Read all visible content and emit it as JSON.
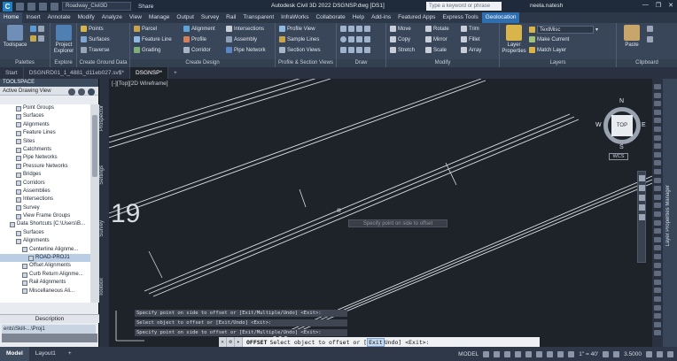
{
  "titlebar": {
    "logo": "C",
    "workspace": "Civil 3D",
    "workspace_field": "Roadway_Civil3D",
    "share": "Share",
    "app_title": "Autodesk Civil 3D 2022   DSGNSP.dwg [DS1]",
    "search_placeholder": "Type a keyword or phrase",
    "user": "neela.natesh"
  },
  "menu_tabs": [
    "Home",
    "Insert",
    "Annotate",
    "Modify",
    "Analyze",
    "View",
    "Manage",
    "Output",
    "Survey",
    "Rail",
    "Transparent",
    "InfraWorks",
    "Collaborate",
    "Help",
    "Add-ins",
    "Featured Apps",
    "Express Tools",
    "Geolocation"
  ],
  "ribbon": {
    "palettes": {
      "label": "Palettes",
      "toolspace": "Toolspace"
    },
    "explore": {
      "label": "Explore",
      "project_explorer": "Project Explorer"
    },
    "ground": {
      "label": "Create Ground Data",
      "items": [
        "Points",
        "Surfaces",
        "Traverse"
      ]
    },
    "design": {
      "label": "Create Design",
      "items": [
        "Parcel",
        "Feature Line",
        "Grading",
        "Alignment",
        "Profile",
        "Corridor",
        "Intersections",
        "Assembly",
        "Pipe Network"
      ]
    },
    "profile_section": {
      "label": "Profile & Section Views",
      "items": [
        "Profile View",
        "Sample Lines",
        "Section Views"
      ]
    },
    "draw": {
      "label": "Draw"
    },
    "modify": {
      "label": "Modify",
      "items": [
        "Move",
        "Rotate",
        "Trim",
        "Copy",
        "Mirror",
        "Fillet",
        "Stretch",
        "Scale",
        "Array"
      ]
    },
    "layers": {
      "label": "Layers",
      "layer_properties": "Layer Properties",
      "current_layer": "TextMisc",
      "make_current": "Make Current",
      "match_layer": "Match Layer"
    },
    "clipboard": {
      "label": "Clipboard",
      "paste": "Paste"
    }
  },
  "doc_tabs": [
    "Start",
    "DSGNRD01_1_4881_d11eb027.sv$*",
    "DSGNSP*"
  ],
  "toolspace": {
    "header": "TOOLSPACE",
    "view": "Active Drawing View",
    "tree": [
      "Point Groups",
      "Surfaces",
      "Alignments",
      "Feature Lines",
      "Sites",
      "Catchments",
      "Pipe Networks",
      "Pressure Networks",
      "Bridges",
      "Corridors",
      "Assemblies",
      "Intersections",
      "Survey",
      "View Frame Groups",
      "Data Shortcuts [C:\\Users\\B...",
      "Surfaces",
      "Alignments",
      "Centerline Alignme...",
      "ROAD-PROJ1",
      "Offset Alignments",
      "Curb Return Alignme...",
      "Rail Alignments",
      "Miscellaneous Ali..."
    ],
    "description_label": "Description",
    "description_value": "ents\\Skill-...\\Proj1"
  },
  "side_tabs": [
    "Prospector",
    "Settings",
    "Survey",
    "Toolbox"
  ],
  "viewport": {
    "label": "[-][Top][2D Wireframe]",
    "station_text": "19",
    "tooltip": "Specify point on side to offset",
    "viewcube": {
      "top": "TOP",
      "north": "N",
      "south": "S",
      "east": "E",
      "west": "W",
      "wcs": "WCS"
    }
  },
  "command_history": [
    "Specify point on side to offset or [Exit/Multiple/Undo] <Exit>:",
    "Select object to offset or [Exit/Undo] <Exit>:",
    "Specify point on side to offset or [Exit/Multiple/Undo] <Exit>:"
  ],
  "command_line": {
    "name": "OFFSET",
    "prompt": "Select object to offset or [",
    "highlight": "Exit",
    "rest": " Undo] <Exit>:"
  },
  "layer_properties_manager": "Layer Properties Manager",
  "status": {
    "tabs": [
      "Model",
      "Layout1",
      "+"
    ],
    "model": "MODEL",
    "scale": "1\" = 40'",
    "value": "3.5000"
  },
  "colors": {
    "accent": "#2f6fb0",
    "canvas": "#1e2229",
    "ribbon": "#39465a"
  }
}
